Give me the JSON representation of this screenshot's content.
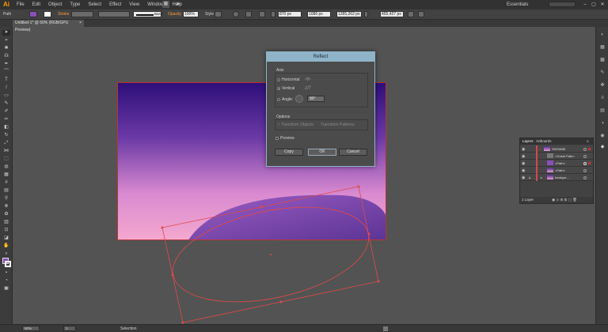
{
  "app": {
    "logo": "Ai"
  },
  "menu": [
    "File",
    "Edit",
    "Object",
    "Type",
    "Select",
    "Effect",
    "View",
    "Window",
    "Help"
  ],
  "workspace": "Essentials",
  "window_controls": [
    "–",
    "▢",
    "✕"
  ],
  "control_bar": {
    "selection_type": "Path",
    "stroke_label": "Stroke",
    "brush_style": "Basic",
    "opacity_label": "Opacity",
    "opacity_value": "100%",
    "style_label": "Style",
    "x_value": "870 px",
    "y_value": "1086 px",
    "w_value": "1285,262 px",
    "h_value": "455,427 px"
  },
  "document_tab": {
    "title": "Untitled-1* @ 50% (RGB/GPU Preview)",
    "close": "×"
  },
  "status_bar": {
    "zoom": "50%",
    "page": "1",
    "tool": "Selection"
  },
  "reflect_dialog": {
    "title": "Reflect",
    "axis_label": "Axis",
    "horizontal_label": "Horizontal",
    "vertical_label": "Vertical",
    "angle_label": "Angle:",
    "angle_value": "90°",
    "options_label": "Options",
    "transform_objects": "Transform Objects",
    "transform_patterns": "Transform Patterns",
    "preview_label": "Preview",
    "copy_label": "Copy",
    "ok_label": "OK",
    "cancel_label": "Cancel",
    "selected_axis": "Vertical"
  },
  "layers_panel": {
    "tabs": [
      "Layers",
      "Artboards"
    ],
    "rows": [
      {
        "name": "SNOW88"
      },
      {
        "name": "<Guide Path>"
      },
      {
        "name": "<Path>"
      },
      {
        "name": "<Path>"
      },
      {
        "name": "backgro..."
      }
    ],
    "footer": "1 Layer"
  },
  "colors": {
    "sky_top": "#2e0f7a",
    "sky_bottom": "#f5a9cf",
    "hill": "#8a4fb8",
    "selection": "#e04a4a",
    "dialog_title": "#8fb3c8"
  }
}
